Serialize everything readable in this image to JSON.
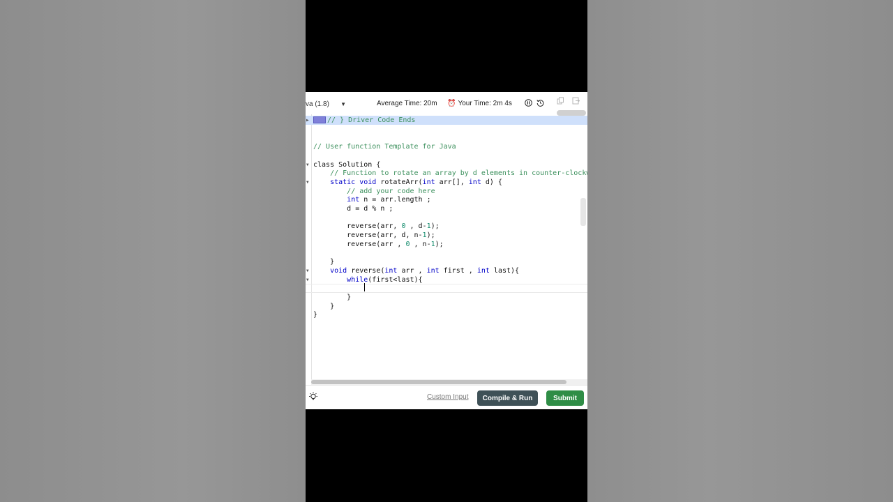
{
  "toolbar": {
    "language": "va (1.8)",
    "average_time": "Average Time: 20m",
    "your_time": "Your Time: 2m 4s"
  },
  "editor": {
    "lines": [
      {
        "parts": [
          {
            "t": "// } Driver Code Ends",
            "c": "cm"
          }
        ],
        "fold": "closed",
        "highlight": true
      },
      {
        "parts": []
      },
      {
        "parts": []
      },
      {
        "parts": [
          {
            "t": "// User function Template for Java",
            "c": "cm"
          }
        ]
      },
      {
        "parts": []
      },
      {
        "parts": [
          {
            "t": "class Solution {",
            "c": "ch"
          }
        ],
        "fold": "open"
      },
      {
        "parts": [
          {
            "t": "    "
          },
          {
            "t": "// Function to rotate an array by d elements in counter-clockwise direction.",
            "c": "cm"
          }
        ]
      },
      {
        "parts": [
          {
            "t": "    static void ",
            "c": "kw"
          },
          {
            "t": "rotateArr(",
            "c": "ch"
          },
          {
            "t": "int",
            "c": "kw"
          },
          {
            "t": " arr[], ",
            "c": "ch"
          },
          {
            "t": "int",
            "c": "kw"
          },
          {
            "t": " d) {",
            "c": "ch"
          }
        ],
        "fold": "open"
      },
      {
        "parts": [
          {
            "t": "        "
          },
          {
            "t": "// add your code here",
            "c": "cm"
          }
        ]
      },
      {
        "parts": [
          {
            "t": "        "
          },
          {
            "t": "int",
            "c": "kw"
          },
          {
            "t": " n = arr.length ;",
            "c": "ch"
          }
        ]
      },
      {
        "parts": [
          {
            "t": "        d = d % n ;",
            "c": "ch"
          }
        ]
      },
      {
        "parts": []
      },
      {
        "parts": [
          {
            "t": "        reverse(arr, ",
            "c": "ch"
          },
          {
            "t": "0",
            "c": "nm"
          },
          {
            "t": " , d-",
            "c": "ch"
          },
          {
            "t": "1",
            "c": "nm"
          },
          {
            "t": ");",
            "c": "ch"
          }
        ]
      },
      {
        "parts": [
          {
            "t": "        reverse(arr, d, n-",
            "c": "ch"
          },
          {
            "t": "1",
            "c": "nm"
          },
          {
            "t": ");",
            "c": "ch"
          }
        ]
      },
      {
        "parts": [
          {
            "t": "        reverse(arr , ",
            "c": "ch"
          },
          {
            "t": "0",
            "c": "nm"
          },
          {
            "t": " , n-",
            "c": "ch"
          },
          {
            "t": "1",
            "c": "nm"
          },
          {
            "t": ");",
            "c": "ch"
          }
        ]
      },
      {
        "parts": []
      },
      {
        "parts": [
          {
            "t": "    }",
            "c": "ch"
          }
        ]
      },
      {
        "parts": [
          {
            "t": "    "
          },
          {
            "t": "void",
            "c": "kw"
          },
          {
            "t": " reverse(",
            "c": "ch"
          },
          {
            "t": "int",
            "c": "kw"
          },
          {
            "t": " arr , ",
            "c": "ch"
          },
          {
            "t": "int",
            "c": "kw"
          },
          {
            "t": " first , ",
            "c": "ch"
          },
          {
            "t": "int",
            "c": "kw"
          },
          {
            "t": " last){",
            "c": "ch"
          }
        ],
        "fold": "open"
      },
      {
        "parts": [
          {
            "t": "        "
          },
          {
            "t": "while",
            "c": "kw"
          },
          {
            "t": "(first<last){",
            "c": "ch"
          }
        ],
        "fold": "open"
      },
      {
        "parts": [
          {
            "t": "            "
          }
        ],
        "active": true
      },
      {
        "parts": [
          {
            "t": "        }",
            "c": "ch"
          }
        ]
      },
      {
        "parts": [
          {
            "t": "    }",
            "c": "ch"
          }
        ]
      },
      {
        "parts": [
          {
            "t": "}",
            "c": "ch"
          }
        ]
      }
    ]
  },
  "footer": {
    "custom_input": "Custom Input",
    "compile_run": "Compile & Run",
    "submit": "Submit"
  }
}
